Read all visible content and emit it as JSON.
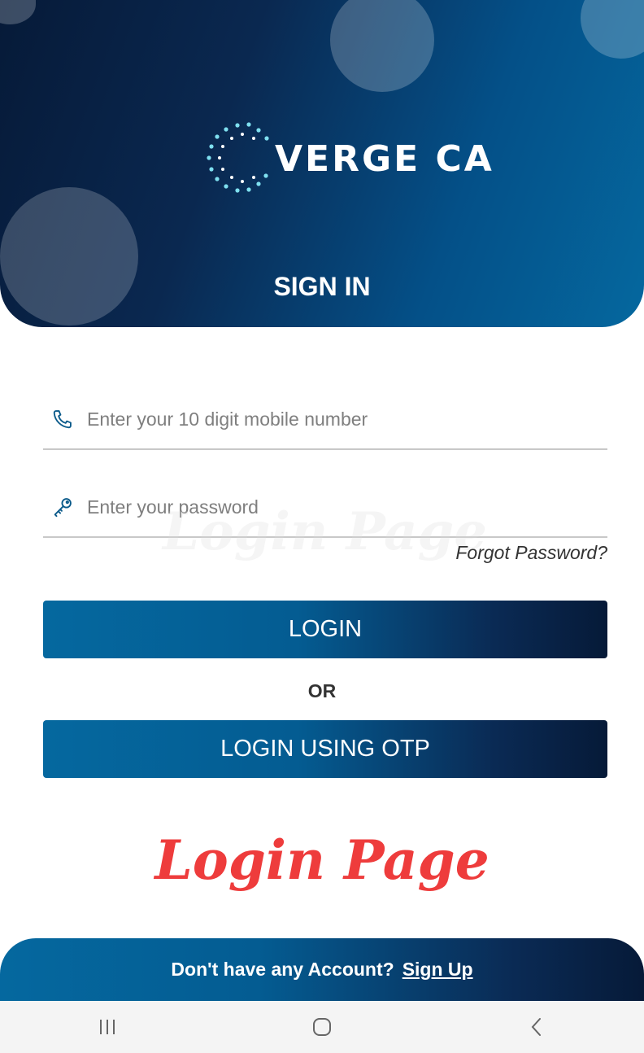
{
  "header": {
    "brand": "VERGE CA",
    "title": "SIGN IN"
  },
  "form": {
    "phone": {
      "placeholder": "Enter your 10 digit mobile number",
      "icon": "phone-icon"
    },
    "password": {
      "placeholder": "Enter your password",
      "icon": "key-icon"
    },
    "forgot_label": "Forgot Password?",
    "login_label": "LOGIN",
    "or_label": "OR",
    "otp_label": "LOGIN USING OTP"
  },
  "watermark": "Login Page",
  "footer": {
    "prompt": "Don't have any Account?",
    "signup_label": "Sign Up"
  },
  "colors": {
    "primary_dark": "#061a38",
    "primary_blue": "#05689f",
    "watermark_red": "#ee3c3c"
  },
  "navbar": [
    "recent-apps-icon",
    "home-icon",
    "back-icon"
  ]
}
